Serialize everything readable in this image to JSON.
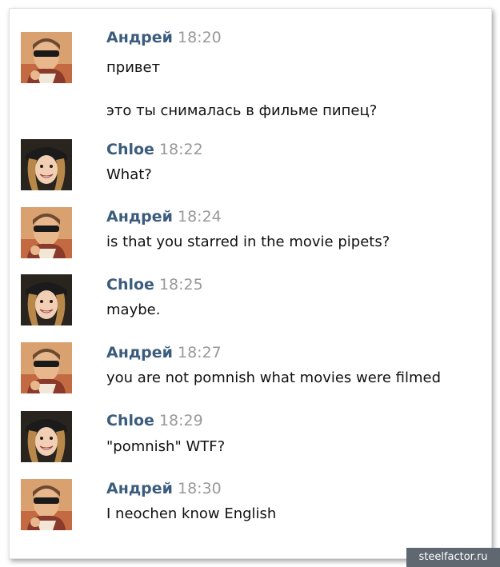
{
  "chat": {
    "messages": [
      {
        "author": "Андрей",
        "time": "18:20",
        "lines": [
          "привет",
          "это ты снималась в фильме пипец?"
        ]
      },
      {
        "author": "Chloe",
        "time": "18:22",
        "lines": [
          "What?"
        ]
      },
      {
        "author": "Андрей",
        "time": "18:24",
        "lines": [
          "is that you starred in the movie pipets?"
        ]
      },
      {
        "author": "Chloe",
        "time": "18:25",
        "lines": [
          "maybe."
        ]
      },
      {
        "author": "Андрей",
        "time": "18:27",
        "lines": [
          "you are not pomnish what movies were filmed"
        ]
      },
      {
        "author": "Chloe",
        "time": "18:29",
        "lines": [
          "\"pomnish\" WTF?"
        ]
      },
      {
        "author": "Андрей",
        "time": "18:30",
        "lines": [
          "I neochen know English"
        ]
      }
    ]
  },
  "watermark": "steelfactor.ru",
  "colors": {
    "author": "#3b5c7d",
    "time": "#999999",
    "text": "#111111",
    "watermark_bg": "#5f6770"
  }
}
